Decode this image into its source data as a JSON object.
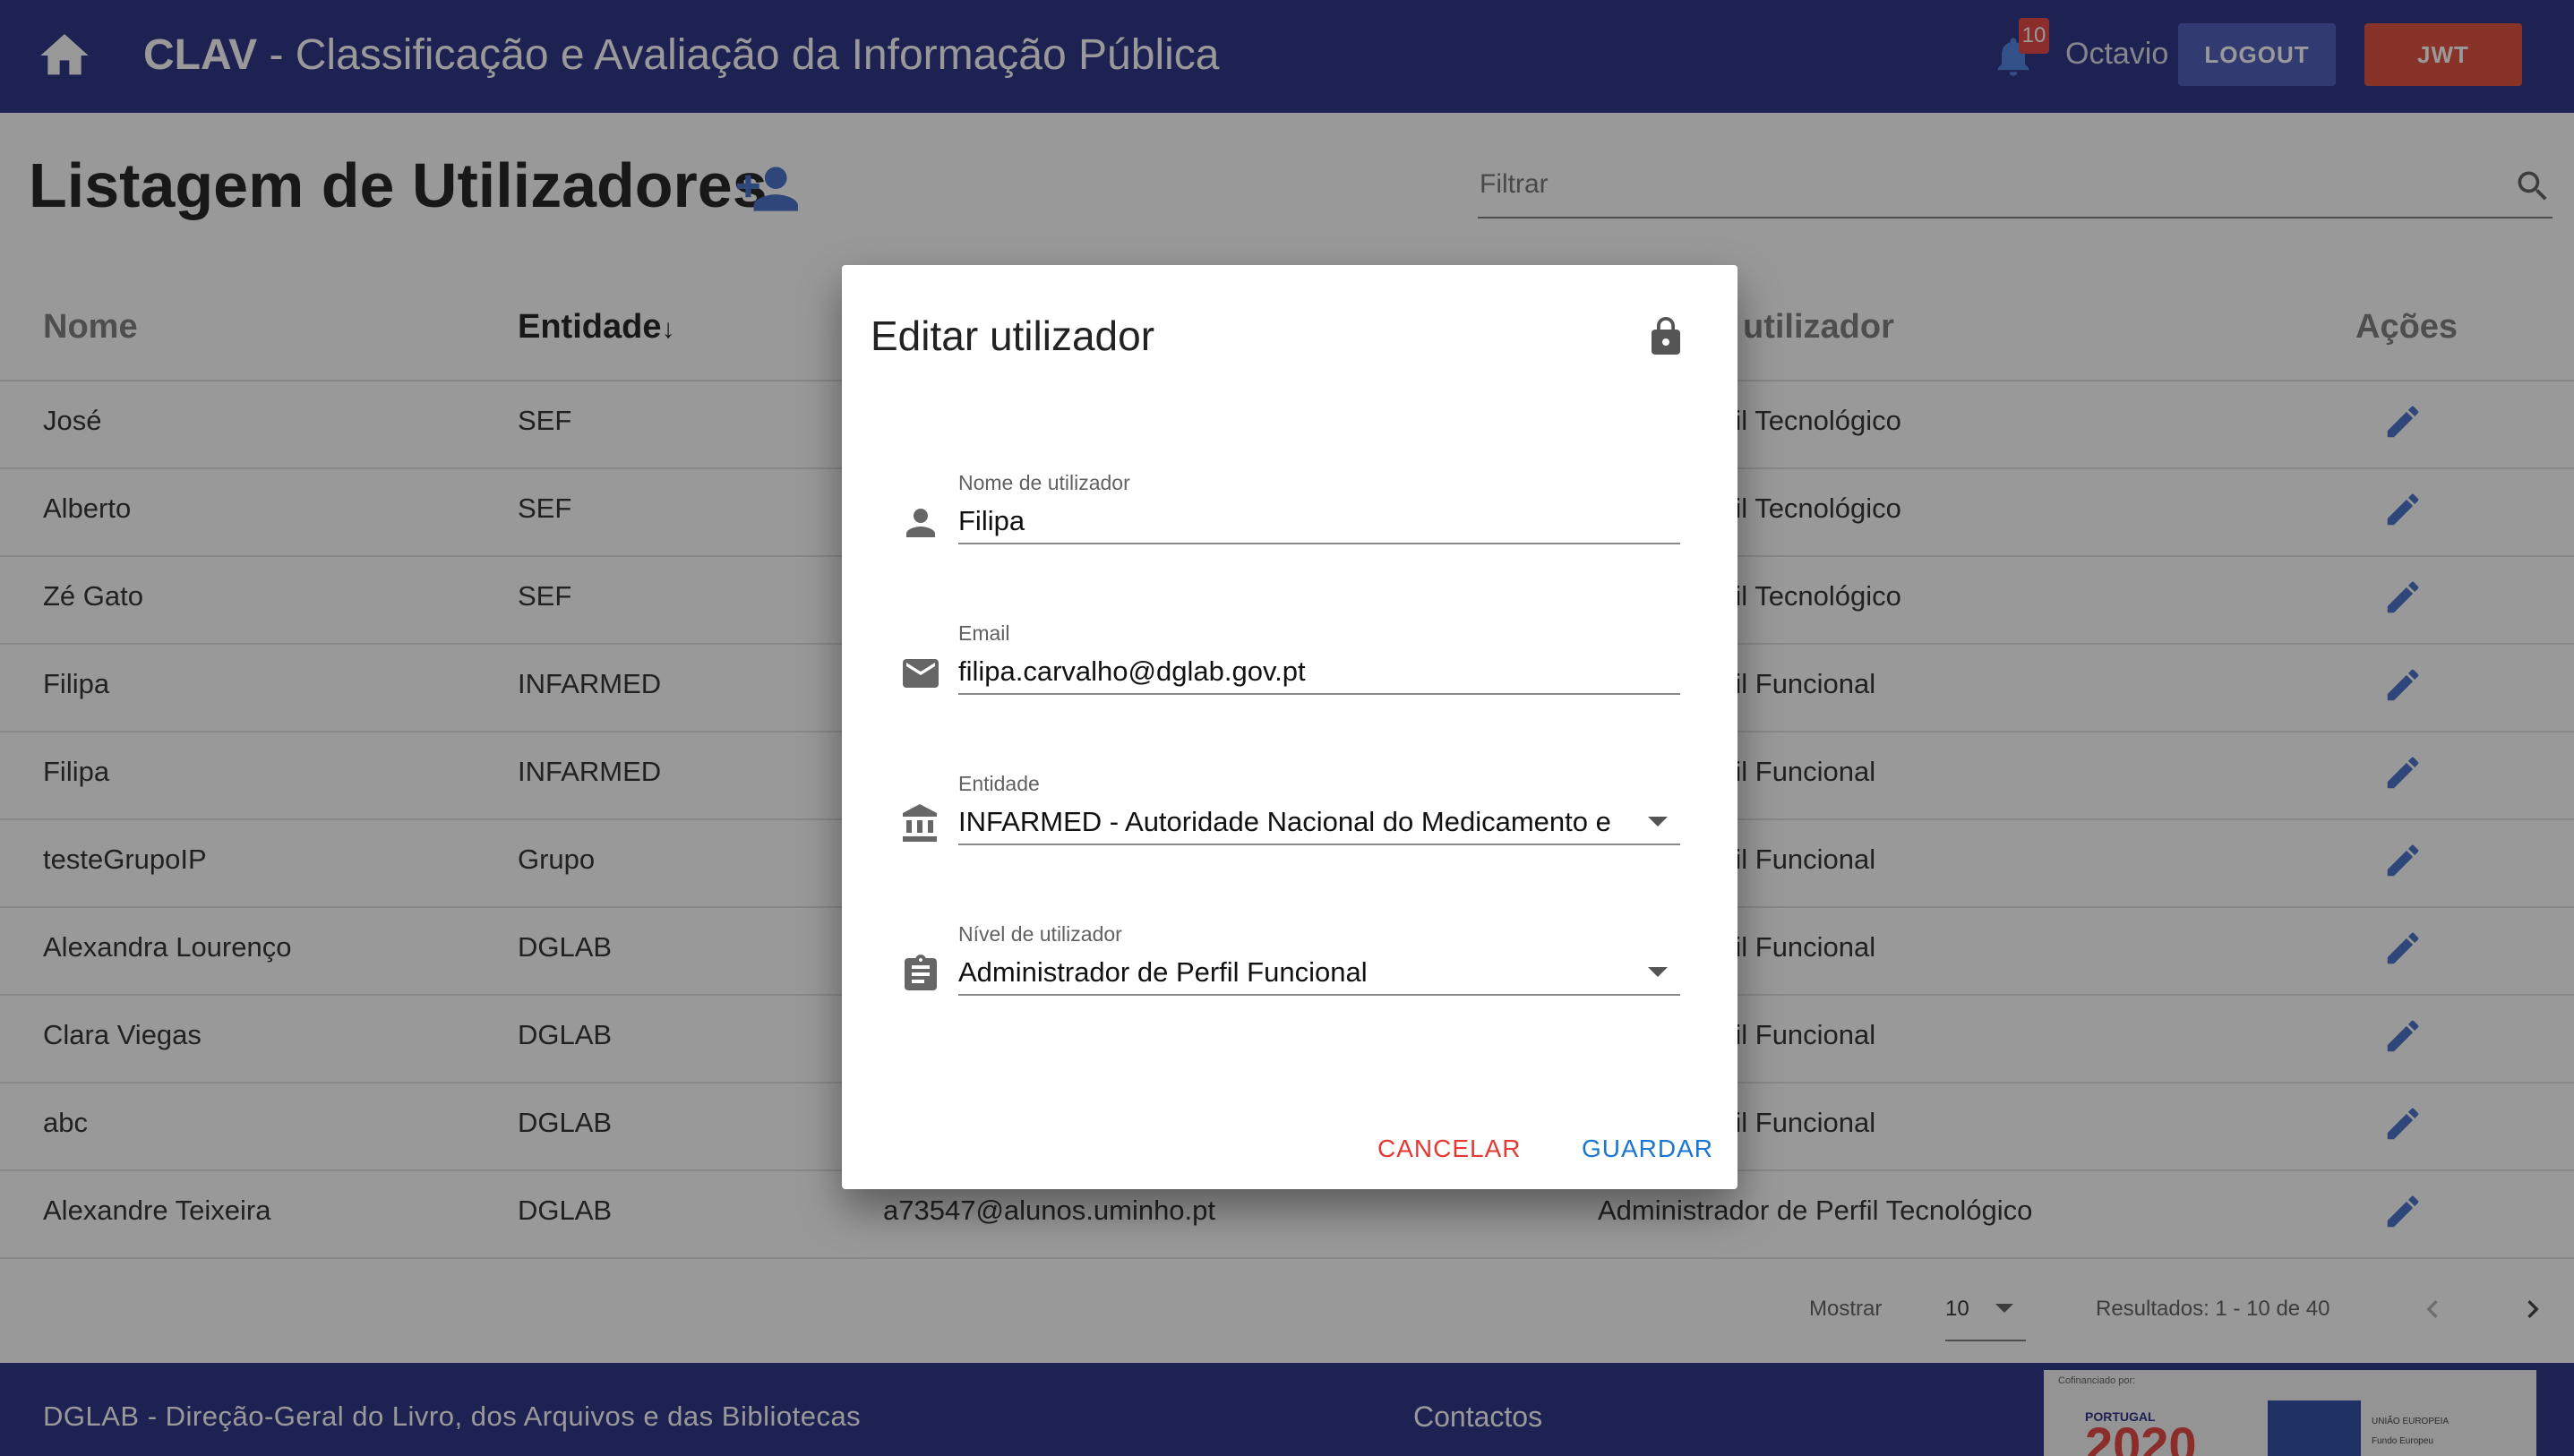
{
  "header": {
    "brand": "CLAV",
    "title_rest": " - Classificação e Avaliação da Informação Pública",
    "notifications_count": "10",
    "username": "Octavio",
    "logout_label": "LOGOUT",
    "jwt_label": "JWT",
    "colors": {
      "bar": "#1a237e",
      "logout": "#3f51b5",
      "jwt": "#e0432f"
    }
  },
  "page": {
    "title": "Listagem de Utilizadores",
    "filter_placeholder": "Filtrar"
  },
  "table": {
    "columns": [
      "Nome",
      "Entidade",
      "utilizador",
      "Ações"
    ],
    "sorted_column": "Entidade",
    "rows": [
      {
        "nome": "José",
        "entidade": "SEF",
        "email": "",
        "nivel": "dor de Perfil Tecnológico"
      },
      {
        "nome": "Alberto",
        "entidade": "SEF",
        "email": "",
        "nivel": "dor de Perfil Tecnológico"
      },
      {
        "nome": "Zé Gato",
        "entidade": "SEF",
        "email": "",
        "nivel": "dor de Perfil Tecnológico"
      },
      {
        "nome": "Filipa",
        "entidade": "INFARMED",
        "email": "",
        "nivel": "dor de Perfil Funcional"
      },
      {
        "nome": "Filipa",
        "entidade": "INFARMED",
        "email": "",
        "nivel": "dor de Perfil Funcional"
      },
      {
        "nome": "testeGrupoIP",
        "entidade": "Grupo",
        "email": "",
        "nivel": "dor de Perfil Funcional"
      },
      {
        "nome": "Alexandra Lourenço",
        "entidade": "DGLAB",
        "email": "",
        "nivel": "dor de Perfil Funcional"
      },
      {
        "nome": "Clara Viegas",
        "entidade": "DGLAB",
        "email": "",
        "nivel": "dor de Perfil Funcional"
      },
      {
        "nome": "abc",
        "entidade": "DGLAB",
        "email": "",
        "nivel": "dor de Perfil Funcional"
      },
      {
        "nome": "Alexandre Teixeira",
        "entidade": "DGLAB",
        "email": "a73547@alunos.uminho.pt",
        "nivel": "Administrador de Perfil Tecnológico"
      }
    ]
  },
  "pagination": {
    "show_label": "Mostrar",
    "per_page": "10",
    "results": "Resultados: 1 - 10 de 40"
  },
  "footer": {
    "org": "DGLAB - Direção-Geral do Livro, dos Arquivos e das Bibliotecas",
    "contacts": "Contactos",
    "logo": {
      "cofinanced": "Cofinanciado por:",
      "portugal": "PORTUGAL",
      "year": "2020",
      "eu": "UNIÃO EUROPEIA",
      "fund": "Fundo Europeu"
    }
  },
  "dialog": {
    "title": "Editar utilizador",
    "fields": {
      "nome": {
        "label": "Nome de utilizador",
        "value": "Filipa"
      },
      "email": {
        "label": "Email",
        "value": "filipa.carvalho@dglab.gov.pt"
      },
      "entidade": {
        "label": "Entidade",
        "value": "INFARMED - Autoridade Nacional do Medicamento e"
      },
      "nivel": {
        "label": "Nível de utilizador",
        "value": "Administrador de Perfil Funcional"
      }
    },
    "cancel_label": "CANCELAR",
    "save_label": "GUARDAR",
    "colors": {
      "cancel": "#e53935",
      "save": "#1976d2"
    }
  }
}
